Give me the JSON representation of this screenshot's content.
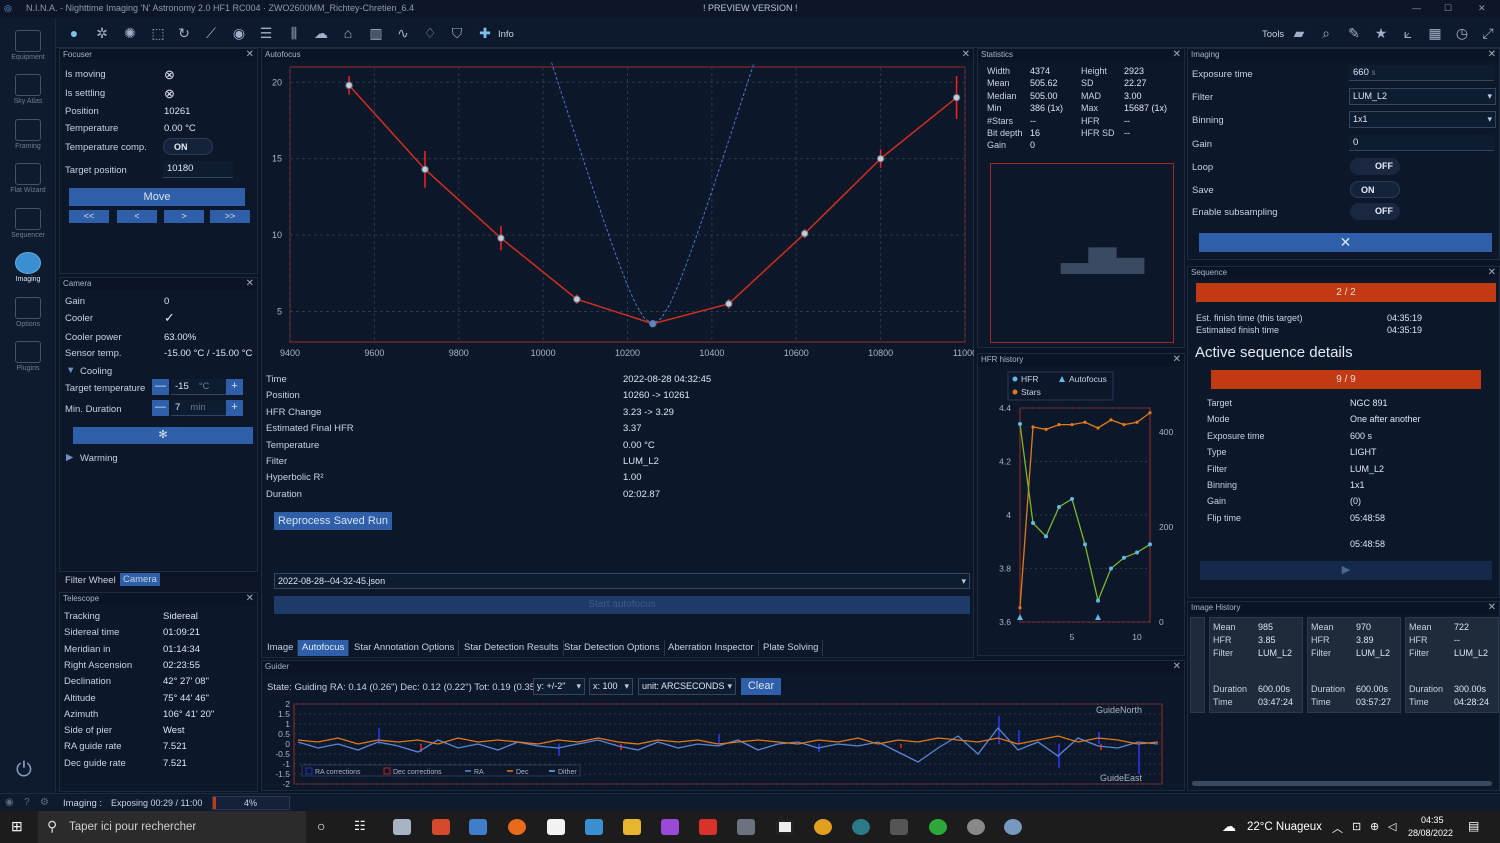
{
  "window": {
    "title": "N.I.N.A. - Nighttime Imaging 'N' Astronomy 2.0 HF1 RC004 · ZWO2600MM_Richtey-Chretien_6.4",
    "preview": "! PREVIEW VERSION !"
  },
  "toolbar": {
    "info_label": "Info",
    "tools_label": "Tools"
  },
  "sidebar": {
    "items": [
      {
        "label": "Equipment"
      },
      {
        "label": "Sky Atlas"
      },
      {
        "label": "Framing"
      },
      {
        "label": "Flat Wizard"
      },
      {
        "label": "Sequencer"
      },
      {
        "label": "Imaging"
      },
      {
        "label": "Options"
      },
      {
        "label": "Plugins"
      }
    ]
  },
  "focuser": {
    "title": "Focuser",
    "rows": [
      {
        "label": "Is moving",
        "value": "⊗"
      },
      {
        "label": "Is settling",
        "value": "⊗"
      },
      {
        "label": "Position",
        "value": "10261"
      },
      {
        "label": "Temperature",
        "value": "0.00 °C"
      }
    ],
    "temp_comp_label": "Temperature comp.",
    "temp_comp_value": "ON",
    "target_label": "Target position",
    "target_value": "10180",
    "move_label": "Move",
    "step_buttons": [
      "<<",
      "<",
      ">",
      ">>"
    ]
  },
  "camera": {
    "title": "Camera",
    "rows": [
      {
        "label": "Gain",
        "value": "0"
      },
      {
        "label": "Cooler",
        "value": "✓"
      },
      {
        "label": "Cooler power",
        "value": "63.00%"
      },
      {
        "label": "Sensor temp.",
        "value": "-15.00 °C / -15.00 °C"
      }
    ],
    "cooling_label": "Cooling",
    "target_temp_label": "Target temperature",
    "target_temp_value": "-15",
    "target_temp_unit": "°C",
    "min_duration_label": "Min. Duration",
    "min_duration_value": "7",
    "min_duration_unit": "min",
    "minus": "—",
    "plus": "+",
    "warming_label": "Warming"
  },
  "bottom_tabs_left": {
    "filter_wheel": "Filter Wheel",
    "camera": "Camera"
  },
  "telescope": {
    "title": "Telescope",
    "rows": [
      {
        "label": "Tracking",
        "value": "Sidereal"
      },
      {
        "label": "Sidereal time",
        "value": "01:09:21"
      },
      {
        "label": "Meridian in",
        "value": "01:14:34"
      },
      {
        "label": "Right Ascension",
        "value": "02:23:55"
      },
      {
        "label": "Declination",
        "value": "42° 27' 08\""
      },
      {
        "label": "Altitude",
        "value": "75° 44' 46\""
      },
      {
        "label": "Azimuth",
        "value": "106° 41' 20\""
      },
      {
        "label": "Side of pier",
        "value": "West"
      },
      {
        "label": "RA guide rate",
        "value": "7.521"
      },
      {
        "label": "Dec guide rate",
        "value": "7.521"
      }
    ]
  },
  "autofocus": {
    "title": "Autofocus",
    "rows": [
      {
        "label": "Time",
        "value": "2022-08-28 04:32:45"
      },
      {
        "label": "Position",
        "value": "10260 -> 10261"
      },
      {
        "label": "HFR Change",
        "value": "3.23 -> 3.29"
      },
      {
        "label": "Estimated Final HFR",
        "value": "3.37"
      },
      {
        "label": "Temperature",
        "value": "0.00 °C"
      },
      {
        "label": "Filter",
        "value": "LUM_L2"
      },
      {
        "label": "Hyperbolic R²",
        "value": "1.00"
      },
      {
        "label": "Duration",
        "value": "02:02.87"
      }
    ],
    "reprocess_label": "Reprocess Saved Run",
    "file_value": "2022-08-28--04-32-45.json",
    "start_label": "Start autofocus"
  },
  "center_tabs": [
    "Image",
    "Autofocus",
    "Star Annotation Options",
    "Star Detection Results",
    "Star Detection Options",
    "Aberration Inspector",
    "Plate Solving"
  ],
  "statistics": {
    "title": "Statistics",
    "left": [
      {
        "label": "Width",
        "value": "4374"
      },
      {
        "label": "Mean",
        "value": "505.62"
      },
      {
        "label": "Median",
        "value": "505.00"
      },
      {
        "label": "Min",
        "value": "386 (1x)"
      },
      {
        "label": "#Stars",
        "value": "--"
      },
      {
        "label": "Bit depth",
        "value": "16"
      },
      {
        "label": "Gain",
        "value": "0"
      }
    ],
    "right": [
      {
        "label": "Height",
        "value": "2923"
      },
      {
        "label": "SD",
        "value": "22.27"
      },
      {
        "label": "MAD",
        "value": "3.00"
      },
      {
        "label": "Max",
        "value": "15687 (1x)"
      },
      {
        "label": "HFR",
        "value": "--"
      },
      {
        "label": "HFR SD",
        "value": "--"
      }
    ]
  },
  "hfr_history": {
    "title": "HFR history",
    "legend_hfr": "HFR",
    "legend_autofocus": "Autofocus",
    "legend_stars": "Stars"
  },
  "imaging": {
    "title": "Imaging",
    "rows": [
      {
        "label": "Exposure time",
        "value": "660",
        "unit": "s"
      },
      {
        "label": "Filter",
        "value": "LUM_L2"
      },
      {
        "label": "Binning",
        "value": "1x1"
      },
      {
        "label": "Gain",
        "value": "0"
      }
    ],
    "loop_label": "Loop",
    "loop_value": "OFF",
    "save_label": "Save",
    "save_value": "ON",
    "subsample_label": "Enable subsampling",
    "subsample_value": "OFF"
  },
  "sequence": {
    "title": "Sequence",
    "progress": "2 / 2",
    "finish_label": "Est. finish time (this target)",
    "finish_value": "04:35:19",
    "est_label": "Estimated finish time",
    "est_value": "04:35:19",
    "active_title": "Active sequence details",
    "active_progress": "9 / 9",
    "details": [
      {
        "label": "Target",
        "value": "NGC 891"
      },
      {
        "label": "Mode",
        "value": "One after another"
      },
      {
        "label": "Exposure time",
        "value": "600 s"
      },
      {
        "label": "Type",
        "value": "LIGHT"
      },
      {
        "label": "Filter",
        "value": "LUM_L2"
      },
      {
        "label": "Binning",
        "value": "1x1"
      },
      {
        "label": "Gain",
        "value": "(0)"
      },
      {
        "label": "Flip time",
        "value": "05:48:58"
      }
    ],
    "flip_extra": "05:48:58"
  },
  "image_history": {
    "title": "Image History",
    "cards": [
      {
        "mean": "985",
        "hfr": "3.85",
        "filter": "LUM_L2",
        "duration": "600.00s",
        "time": "03:47:24"
      },
      {
        "mean": "970",
        "hfr": "3.89",
        "filter": "LUM_L2",
        "duration": "600.00s",
        "time": "03:57:27"
      },
      {
        "mean": "722",
        "hfr": "--",
        "filter": "LUM_L2",
        "duration": "300.00s",
        "time": "04:28:24"
      }
    ],
    "labels": {
      "mean": "Mean",
      "hfr": "HFR",
      "filter": "Filter",
      "duration": "Duration",
      "time": "Time"
    }
  },
  "guider": {
    "title": "Guider",
    "state": "State: Guiding  RA: 0.14 (0.26\")  Dec: 0.12 (0.22\")  Tot: 0.19 (0.35\")",
    "y_sel": "y: +/-2\"",
    "x_sel": "x: 100",
    "unit_sel": "unit: ARCSECONDS",
    "clear_label": "Clear",
    "north_label": "GuideNorth",
    "east_label": "GuideEast",
    "legend": [
      "RA corrections",
      "Dec corrections",
      "RA",
      "Dec",
      "Dither"
    ]
  },
  "status": {
    "imaging_label": "Imaging :",
    "exposing": "Exposing 00:29 / 11:00",
    "percent": "4%",
    "progress": 0.04
  },
  "taskbar": {
    "search_placeholder": "Taper ici pour rechercher",
    "weather": "22°C  Nuageux",
    "time": "04:35",
    "date": "28/08/2022"
  },
  "chart_data": [
    {
      "type": "scatter",
      "title": "Autofocus",
      "x": [
        9540,
        9720,
        9900,
        10080,
        10260,
        10440,
        10620,
        10800,
        10980
      ],
      "y": [
        19.8,
        14.3,
        9.8,
        5.8,
        4.2,
        5.5,
        10.1,
        15.0,
        19.0
      ],
      "err": [
        0.6,
        1.2,
        0.8,
        0.3,
        0.2,
        0.3,
        0.3,
        0.6,
        1.4
      ],
      "xlim": [
        9400,
        11000
      ],
      "ylim": [
        3,
        21
      ],
      "xticks": [
        9400,
        9600,
        9800,
        10000,
        10200,
        10400,
        10600,
        10800,
        11000
      ],
      "yticks": [
        5,
        10,
        15,
        20
      ]
    },
    {
      "type": "line",
      "title": "HFR history",
      "x": [
        1,
        2,
        3,
        4,
        5,
        6,
        7,
        8,
        9,
        10,
        11
      ],
      "series": [
        {
          "name": "HFR",
          "values": [
            4.34,
            3.97,
            3.92,
            4.03,
            4.06,
            3.89,
            3.68,
            3.8,
            3.84,
            3.86,
            3.89
          ]
        },
        {
          "name": "Stars",
          "values": [
            30,
            410,
            405,
            415,
            415,
            420,
            408,
            425,
            415,
            420,
            440
          ]
        }
      ],
      "ylim_left": [
        3.6,
        4.4
      ],
      "yticks_left": [
        3.6,
        3.8,
        4,
        4.2,
        4.4
      ],
      "ylim_right": [
        0,
        450
      ],
      "yticks_right": [
        0,
        200,
        400
      ],
      "xticks": [
        5,
        10
      ]
    },
    {
      "type": "line",
      "title": "Guider",
      "series": [
        {
          "name": "RA",
          "values": [
            0.1,
            -0.2,
            0.0,
            -0.3,
            0.1,
            -0.1,
            -0.4,
            0.2,
            -0.2,
            0.0,
            -0.3,
            0.1,
            -0.1,
            -0.2,
            0.0,
            0.2,
            -0.1,
            -0.3,
            0.1,
            -0.2,
            0.0,
            -0.1,
            0.2,
            -0.3,
            0.0,
            0.1,
            -0.2,
            0.0,
            -0.1,
            0.1,
            -0.4,
            -0.9,
            -0.2,
            0.4,
            -0.5,
            0.8,
            -0.3,
            0.1,
            -0.6,
            0.3,
            -0.1,
            -0.2,
            0.1,
            0.0
          ]
        },
        {
          "name": "Dec",
          "values": [
            0.2,
            0.1,
            0.3,
            0.0,
            0.2,
            0.1,
            0.2,
            0.0,
            0.3,
            0.1,
            0.2,
            0.1,
            0.0,
            0.2,
            0.1,
            0.3,
            0.1,
            0.0,
            0.2,
            0.1,
            0.2,
            0.0,
            0.1,
            0.2,
            0.1,
            0.0,
            0.2,
            0.1,
            0.3,
            0.0,
            0.2,
            0.1,
            0.3,
            0.2,
            0.1,
            0.3,
            0.0,
            0.2,
            0.4,
            0.1,
            0.3,
            0.2,
            0.0,
            0.1
          ]
        }
      ],
      "ylim": [
        -2,
        2
      ],
      "yticks": [
        2,
        1.5,
        1,
        0.5,
        0,
        -0.5,
        -1,
        -1.5,
        -2
      ]
    }
  ]
}
